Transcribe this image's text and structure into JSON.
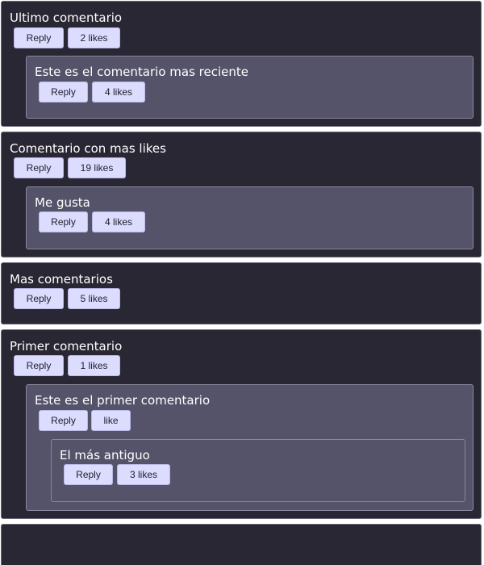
{
  "comments": [
    {
      "text": "Ultimo comentario",
      "reply_label": "Reply",
      "likes_label": "2 likes",
      "replies": [
        {
          "text": "Este es el comentario mas reciente",
          "reply_label": "Reply",
          "likes_label": "4 likes"
        }
      ]
    },
    {
      "text": "Comentario con mas likes",
      "reply_label": "Reply",
      "likes_label": "19 likes",
      "replies": [
        {
          "text": "Me gusta",
          "reply_label": "Reply",
          "likes_label": "4 likes"
        }
      ]
    },
    {
      "text": "Mas comentarios",
      "reply_label": "Reply",
      "likes_label": "5 likes",
      "replies": []
    },
    {
      "text": "Primer comentario",
      "reply_label": "Reply",
      "likes_label": "1 likes",
      "replies": [
        {
          "text": "Este es el primer comentario",
          "reply_label": "Reply",
          "likes_label": "like",
          "replies": [
            {
              "text": "El más antiguo",
              "reply_label": "Reply",
              "likes_label": "3 likes"
            }
          ]
        }
      ]
    }
  ],
  "colors": {
    "thread_bg": "#2a2734",
    "reply_bg": "#55536a",
    "button_bg": "#dcdcff",
    "text": "#ffffff"
  }
}
